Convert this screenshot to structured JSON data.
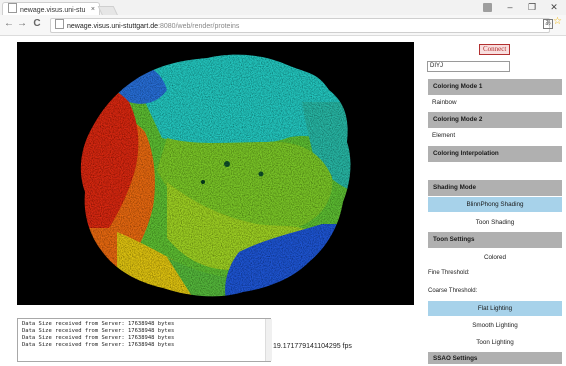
{
  "browser": {
    "tab_title": "newage.visus.uni-stu",
    "tab_close": "×",
    "url_host": "newage.visus.uni-stuttgart.de",
    "url_path": ":8080/web/render/proteins",
    "back": "←",
    "forward": "→",
    "reload": "C",
    "minimize": "–",
    "maximize": "❐",
    "close": "✕"
  },
  "log": {
    "lines": [
      "Data Size received from Server: 17638948 bytes",
      "Data Size received from Server: 17638948 bytes",
      "Data Size received from Server: 17638948 bytes",
      "Data Size received from Server: 17638948 bytes"
    ]
  },
  "fps": "19.171779141104295 fps",
  "sidebar": {
    "connect_label": "Connect",
    "protein_value": "DIYJ",
    "coloring_mode_1": "Coloring Mode 1",
    "coloring_mode_1_value": "Rainbow",
    "coloring_mode_2": "Coloring Mode 2",
    "coloring_mode_2_value": "Element",
    "coloring_interpolation": "Coloring Interpolation",
    "shading_mode": "Shading Mode",
    "shading_options": [
      "BlinnPhong Shading",
      "Toon Shading"
    ],
    "toon_settings": "Toon Settings",
    "colored": "Colored",
    "fine_threshold": "Fine Threshold:",
    "coarse_threshold": "Coarse Threshold:",
    "lighting_options": [
      "Flat Lighting",
      "Smooth Lighting",
      "Toon Lighting"
    ],
    "ssao_settings": "SSAO Settings"
  },
  "colors": {
    "selected": "#a7d2ea",
    "header": "#b0b0b0",
    "canvas": "#000000"
  }
}
